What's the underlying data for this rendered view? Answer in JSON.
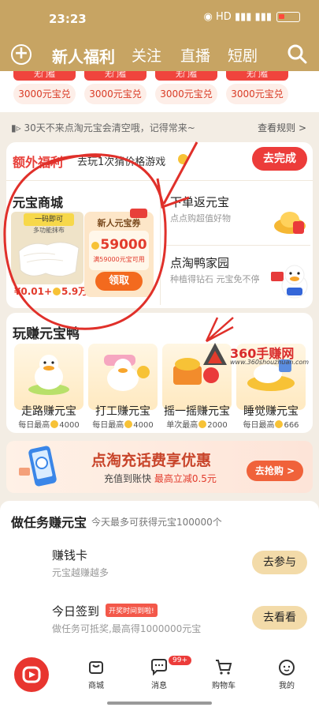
{
  "status": {
    "time": "23:23",
    "icons": "◉ HD ▮▮▮ ▮▮▮"
  },
  "nav": {
    "tabs": [
      "新人福利",
      "关注",
      "直播",
      "短剧"
    ]
  },
  "coupon_strip": {
    "top_tabs": [
      "无门槛",
      "无门槛",
      "无门槛",
      "无门槛"
    ],
    "coupons": [
      "3000元宝兑",
      "3000元宝兑",
      "3000元宝兑",
      "3000元宝兑"
    ]
  },
  "notice": {
    "text": "30天不来点淘元宝会清空哦，记得常来~",
    "rule": "查看规则 >"
  },
  "extra": {
    "title": "额外福利",
    "desc": "去玩1次猜价格游戏",
    "button": "去完成"
  },
  "shop": {
    "title": "元宝商城",
    "product_tag": "一码即可",
    "product_tag2": "多功能抹布",
    "price_left": "¥0.01+",
    "coin_amount": "5.9万",
    "coupon_label": "新人元宝券",
    "coupon_value": "59000",
    "coupon_cond": "满59000元宝可用",
    "claim": "领取"
  },
  "right_cells": [
    {
      "title": "下单返元宝",
      "sub": "点点购超值好物"
    },
    {
      "title": "点淘鸭家园",
      "sub": "种植得钻石 元宝免不停"
    }
  ],
  "play": {
    "title": "玩赚元宝鸭",
    "games": [
      {
        "label": "走路赚元宝",
        "sub_prefix": "每日最高",
        "sub_num": "4000"
      },
      {
        "label": "打工赚元宝",
        "sub_prefix": "每日最高",
        "sub_num": "4000"
      },
      {
        "label": "摇一摇赚元宝",
        "sub_prefix": "单次最高",
        "sub_num": "2000"
      },
      {
        "label": "睡觉赚元宝",
        "sub_prefix": "每日最高",
        "sub_num": "666"
      }
    ]
  },
  "watermark": {
    "main": "360手赚网",
    "url": "www.360shouzhuan.com"
  },
  "banner": {
    "title": "点淘充话费享优惠",
    "sub_prefix": "充值到账快",
    "sub_highlight": "最高立减0.5元",
    "button": "去抢购 >"
  },
  "tasks": {
    "title": "做任务赚元宝",
    "subtitle": "今天最多可获得元宝100000个",
    "items": [
      {
        "title": "赚钱卡",
        "sub": "元宝越赚越多",
        "badge": "",
        "button": "去参与"
      },
      {
        "title": "今日签到",
        "sub": "做任务可抵奖,最高得1000000元宝",
        "badge": "开奖时间到啦!",
        "button": "去看看"
      }
    ]
  },
  "bottom": {
    "items": [
      {
        "label": ""
      },
      {
        "label": "商城"
      },
      {
        "label": "消息",
        "badge": "99+"
      },
      {
        "label": "购物车"
      },
      {
        "label": "我的"
      }
    ]
  },
  "colors": {
    "gold": "#c7a463",
    "red": "#ec3c3a",
    "annotation": "#e0302a"
  }
}
